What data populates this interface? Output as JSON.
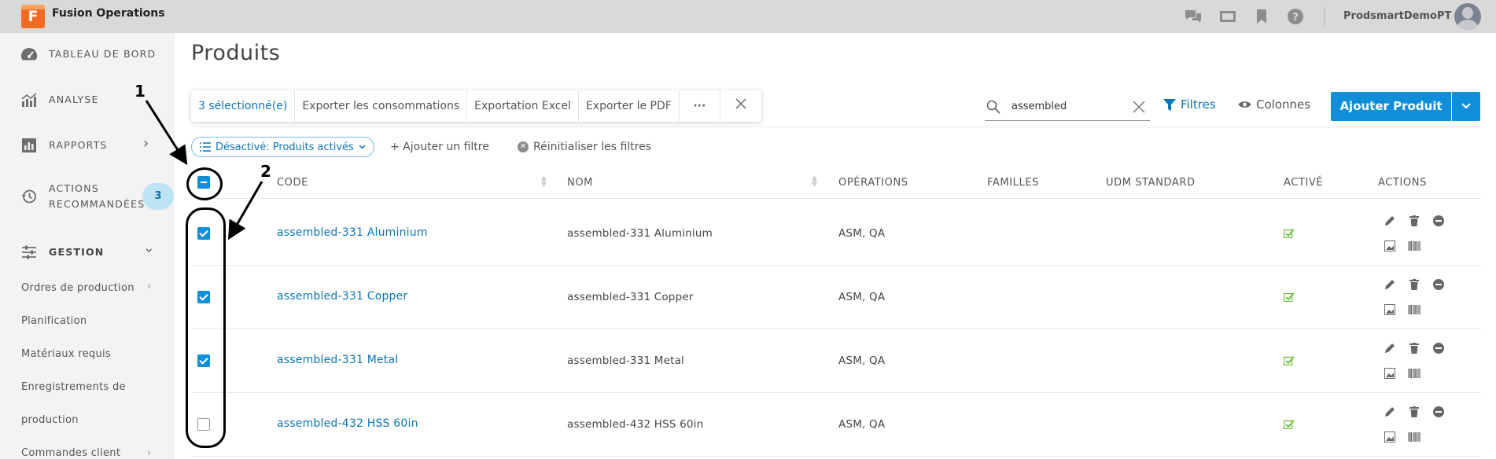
{
  "app": {
    "logo_letter": "F",
    "title": "Fusion Operations",
    "user": "ProdsmartDemoPT"
  },
  "topbar_icons": [
    "chat-icon",
    "screen-icon",
    "bookmark-icon",
    "help-icon"
  ],
  "sidebar": {
    "items": [
      {
        "label": "TABLEAU DE BORD",
        "icon": "dashboard-icon"
      },
      {
        "label": "ANALYSE",
        "icon": "analytics-icon"
      },
      {
        "label": "RAPPORTS",
        "icon": "reports-icon"
      },
      {
        "label_line1": "ACTIONS",
        "label_line2": "RECOMMANDÉES",
        "icon": "history-icon",
        "badge": "3"
      },
      {
        "label": "GESTION",
        "icon": "sliders-icon"
      }
    ],
    "sub_items": [
      "Ordres de production",
      "Planification",
      "Matériaux requis",
      "Enregistrements de",
      "production",
      "Commandes client"
    ]
  },
  "page": {
    "title": "Produits"
  },
  "bulk_actions": {
    "selected": "3 sélectionné(e)",
    "export_consumptions": "Exporter les consommations",
    "export_excel": "Exportation Excel",
    "export_pdf": "Exporter le PDF",
    "more": "···"
  },
  "search": {
    "value": "assembled"
  },
  "toolbar": {
    "filters": "Filtres",
    "columns": "Colonnes",
    "add_product": "Ajouter Produit"
  },
  "filters": {
    "active_chip": "Désactivé: Produits activés",
    "add_filter": "+ Ajouter un filtre",
    "reset": "Réinitialiser les filtres"
  },
  "table": {
    "headers": {
      "code": "CODE",
      "name": "NOM",
      "operations": "OPÉRATIONS",
      "families": "FAMILLES",
      "uom": "UDM STANDARD",
      "active": "ACTIVÉ",
      "actions": "ACTIONS"
    },
    "rows": [
      {
        "code": "assembled-331 Aluminium",
        "name": "assembled-331 Aluminium",
        "operations": "ASM, QA",
        "families": "",
        "uom": "",
        "checked": true,
        "active": true
      },
      {
        "code": "assembled-331 Copper",
        "name": "assembled-331 Copper",
        "operations": "ASM, QA",
        "families": "",
        "uom": "",
        "checked": true,
        "active": true
      },
      {
        "code": "assembled-331 Metal",
        "name": "assembled-331 Metal",
        "operations": "ASM, QA",
        "families": "",
        "uom": "",
        "checked": true,
        "active": true
      },
      {
        "code": "assembled-432 HSS 60in",
        "name": "assembled-432 HSS 60in",
        "operations": "ASM, QA",
        "families": "",
        "uom": "",
        "checked": false,
        "active": true
      }
    ]
  },
  "annotations": {
    "label1": "1",
    "label2": "2"
  },
  "colors": {
    "accent": "#0f8fd8",
    "link": "#0a75b8",
    "active_check": "#6cbf3f",
    "logo": "#f26b22"
  }
}
